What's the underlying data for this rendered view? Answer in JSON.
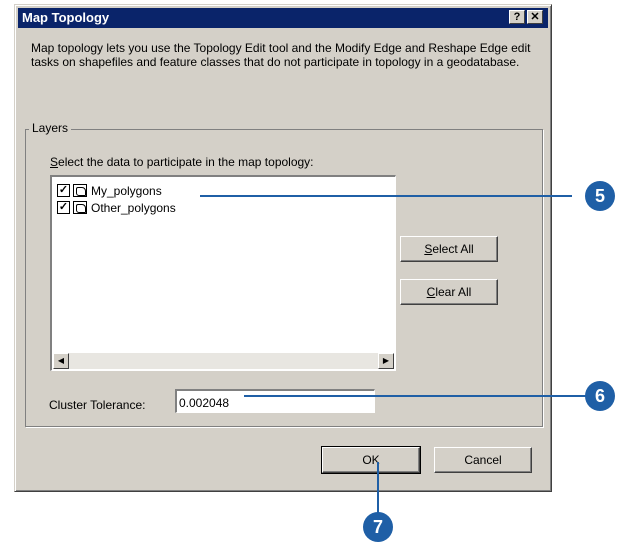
{
  "dialog": {
    "title": "Map Topology",
    "help_label": "?",
    "close_label": "✕",
    "description": "Map topology lets you use the Topology Edit tool and the Modify Edge and Reshape Edge edit tasks on shapefiles and feature classes that do not participate in topology in a geodatabase."
  },
  "layers": {
    "group_label": "Layers",
    "select_prefix": "S",
    "select_rest": "elect the data to participate in the map topology:",
    "items": [
      {
        "label": "My_polygons",
        "checked": true
      },
      {
        "label": "Other_polygons",
        "checked": true
      }
    ],
    "select_all_prefix": "S",
    "select_all_rest": "elect All",
    "clear_all_prefix": "C",
    "clear_all_rest": "lear All"
  },
  "cluster": {
    "label": "Cluster Tolerance:",
    "value": "0.002048"
  },
  "buttons": {
    "ok": "OK",
    "cancel": "Cancel"
  },
  "callouts": {
    "step5": "5",
    "step6": "6",
    "step7": "7",
    "color": "#1f5fa6"
  },
  "scrollbar": {
    "left_arrow": "◀",
    "right_arrow": "▶"
  },
  "checkmark": "✓"
}
